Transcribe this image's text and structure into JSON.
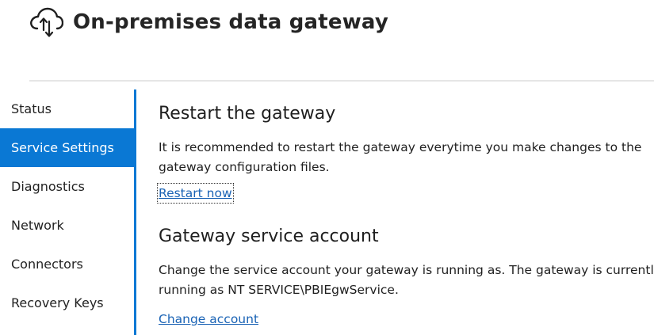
{
  "header": {
    "title": "On-premises data gateway",
    "icon": "cloud-upload-download-icon"
  },
  "sidebar": {
    "items": [
      {
        "label": "Status",
        "active": false
      },
      {
        "label": "Service Settings",
        "active": true
      },
      {
        "label": "Diagnostics",
        "active": false
      },
      {
        "label": "Network",
        "active": false
      },
      {
        "label": "Connectors",
        "active": false
      },
      {
        "label": "Recovery Keys",
        "active": false
      }
    ]
  },
  "restart": {
    "title": "Restart the gateway",
    "line1": "It is recommended to restart the gateway everytime you make changes to the",
    "line2": "gateway configuration files.",
    "link": "Restart now"
  },
  "account": {
    "title": "Gateway service account",
    "line1": "Change the service account your gateway is running as. The gateway is currently",
    "line2": "running as NT SERVICE\\PBIEgwService.",
    "link": "Change account"
  },
  "colors": {
    "accent": "#0a78d4",
    "link": "#1a63b5"
  }
}
